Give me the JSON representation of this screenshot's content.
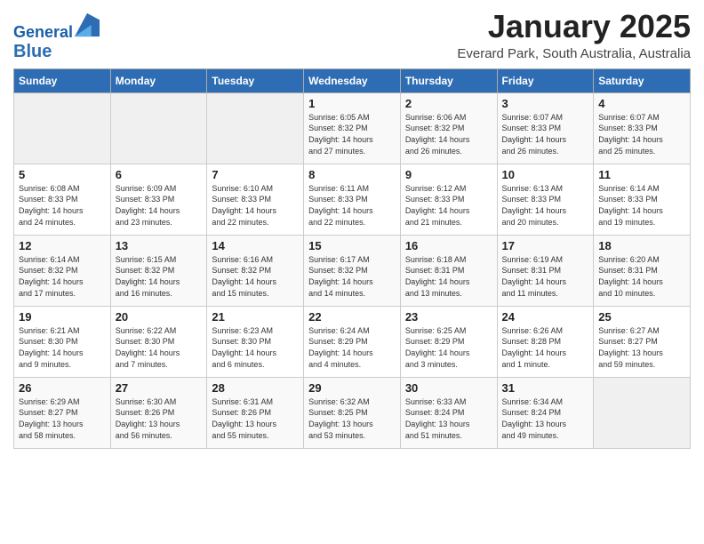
{
  "header": {
    "logo_line1": "General",
    "logo_line2": "Blue",
    "month": "January 2025",
    "location": "Everard Park, South Australia, Australia"
  },
  "days_of_week": [
    "Sunday",
    "Monday",
    "Tuesday",
    "Wednesday",
    "Thursday",
    "Friday",
    "Saturday"
  ],
  "weeks": [
    [
      {
        "day": "",
        "info": ""
      },
      {
        "day": "",
        "info": ""
      },
      {
        "day": "",
        "info": ""
      },
      {
        "day": "1",
        "info": "Sunrise: 6:05 AM\nSunset: 8:32 PM\nDaylight: 14 hours\nand 27 minutes."
      },
      {
        "day": "2",
        "info": "Sunrise: 6:06 AM\nSunset: 8:32 PM\nDaylight: 14 hours\nand 26 minutes."
      },
      {
        "day": "3",
        "info": "Sunrise: 6:07 AM\nSunset: 8:33 PM\nDaylight: 14 hours\nand 26 minutes."
      },
      {
        "day": "4",
        "info": "Sunrise: 6:07 AM\nSunset: 8:33 PM\nDaylight: 14 hours\nand 25 minutes."
      }
    ],
    [
      {
        "day": "5",
        "info": "Sunrise: 6:08 AM\nSunset: 8:33 PM\nDaylight: 14 hours\nand 24 minutes."
      },
      {
        "day": "6",
        "info": "Sunrise: 6:09 AM\nSunset: 8:33 PM\nDaylight: 14 hours\nand 23 minutes."
      },
      {
        "day": "7",
        "info": "Sunrise: 6:10 AM\nSunset: 8:33 PM\nDaylight: 14 hours\nand 22 minutes."
      },
      {
        "day": "8",
        "info": "Sunrise: 6:11 AM\nSunset: 8:33 PM\nDaylight: 14 hours\nand 22 minutes."
      },
      {
        "day": "9",
        "info": "Sunrise: 6:12 AM\nSunset: 8:33 PM\nDaylight: 14 hours\nand 21 minutes."
      },
      {
        "day": "10",
        "info": "Sunrise: 6:13 AM\nSunset: 8:33 PM\nDaylight: 14 hours\nand 20 minutes."
      },
      {
        "day": "11",
        "info": "Sunrise: 6:14 AM\nSunset: 8:33 PM\nDaylight: 14 hours\nand 19 minutes."
      }
    ],
    [
      {
        "day": "12",
        "info": "Sunrise: 6:14 AM\nSunset: 8:32 PM\nDaylight: 14 hours\nand 17 minutes."
      },
      {
        "day": "13",
        "info": "Sunrise: 6:15 AM\nSunset: 8:32 PM\nDaylight: 14 hours\nand 16 minutes."
      },
      {
        "day": "14",
        "info": "Sunrise: 6:16 AM\nSunset: 8:32 PM\nDaylight: 14 hours\nand 15 minutes."
      },
      {
        "day": "15",
        "info": "Sunrise: 6:17 AM\nSunset: 8:32 PM\nDaylight: 14 hours\nand 14 minutes."
      },
      {
        "day": "16",
        "info": "Sunrise: 6:18 AM\nSunset: 8:31 PM\nDaylight: 14 hours\nand 13 minutes."
      },
      {
        "day": "17",
        "info": "Sunrise: 6:19 AM\nSunset: 8:31 PM\nDaylight: 14 hours\nand 11 minutes."
      },
      {
        "day": "18",
        "info": "Sunrise: 6:20 AM\nSunset: 8:31 PM\nDaylight: 14 hours\nand 10 minutes."
      }
    ],
    [
      {
        "day": "19",
        "info": "Sunrise: 6:21 AM\nSunset: 8:30 PM\nDaylight: 14 hours\nand 9 minutes."
      },
      {
        "day": "20",
        "info": "Sunrise: 6:22 AM\nSunset: 8:30 PM\nDaylight: 14 hours\nand 7 minutes."
      },
      {
        "day": "21",
        "info": "Sunrise: 6:23 AM\nSunset: 8:30 PM\nDaylight: 14 hours\nand 6 minutes."
      },
      {
        "day": "22",
        "info": "Sunrise: 6:24 AM\nSunset: 8:29 PM\nDaylight: 14 hours\nand 4 minutes."
      },
      {
        "day": "23",
        "info": "Sunrise: 6:25 AM\nSunset: 8:29 PM\nDaylight: 14 hours\nand 3 minutes."
      },
      {
        "day": "24",
        "info": "Sunrise: 6:26 AM\nSunset: 8:28 PM\nDaylight: 14 hours\nand 1 minute."
      },
      {
        "day": "25",
        "info": "Sunrise: 6:27 AM\nSunset: 8:27 PM\nDaylight: 13 hours\nand 59 minutes."
      }
    ],
    [
      {
        "day": "26",
        "info": "Sunrise: 6:29 AM\nSunset: 8:27 PM\nDaylight: 13 hours\nand 58 minutes."
      },
      {
        "day": "27",
        "info": "Sunrise: 6:30 AM\nSunset: 8:26 PM\nDaylight: 13 hours\nand 56 minutes."
      },
      {
        "day": "28",
        "info": "Sunrise: 6:31 AM\nSunset: 8:26 PM\nDaylight: 13 hours\nand 55 minutes."
      },
      {
        "day": "29",
        "info": "Sunrise: 6:32 AM\nSunset: 8:25 PM\nDaylight: 13 hours\nand 53 minutes."
      },
      {
        "day": "30",
        "info": "Sunrise: 6:33 AM\nSunset: 8:24 PM\nDaylight: 13 hours\nand 51 minutes."
      },
      {
        "day": "31",
        "info": "Sunrise: 6:34 AM\nSunset: 8:24 PM\nDaylight: 13 hours\nand 49 minutes."
      },
      {
        "day": "",
        "info": ""
      }
    ]
  ]
}
